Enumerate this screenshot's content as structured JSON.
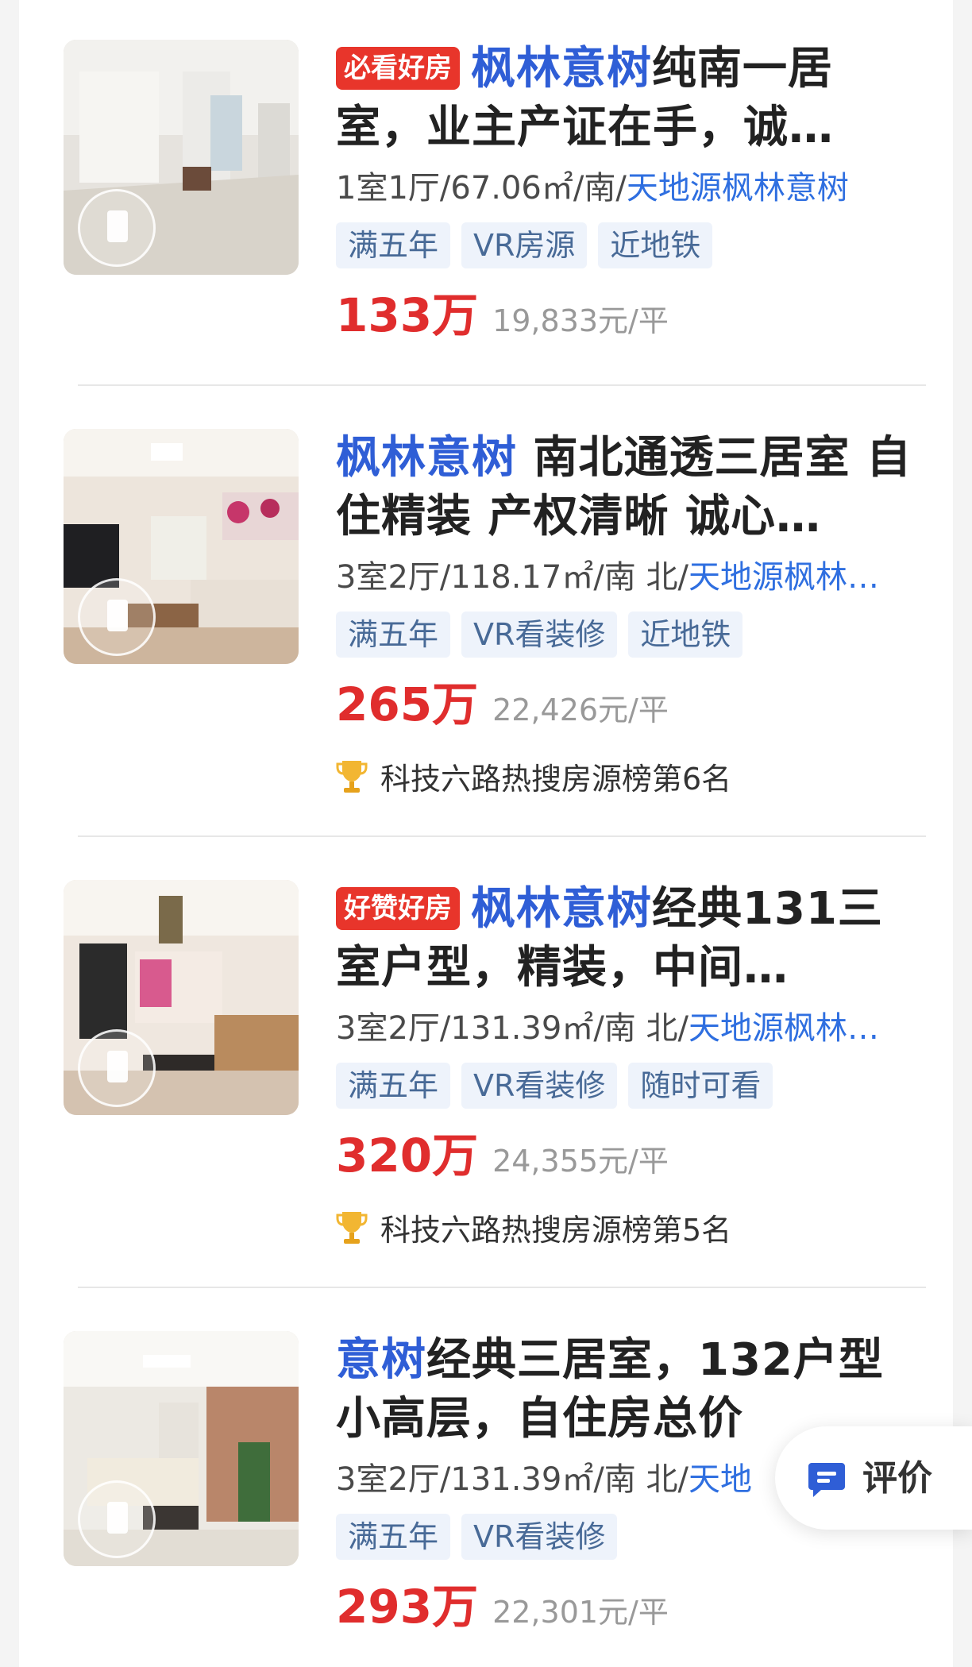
{
  "listings": [
    {
      "badge": "必看好房",
      "community": "枫林意树",
      "title": "纯南一居室，业主产证在手，诚…",
      "layout": "1室1厅/67.06㎡/南/",
      "location": "天地源枫林意树",
      "tags": [
        "满五年",
        "VR房源",
        "近地铁"
      ],
      "price": "133万",
      "unit_price": "19,833元/平",
      "rank": ""
    },
    {
      "badge": "",
      "community": "枫林意树",
      "title": " 南北通透三居室 自住精装 产权清晰 诚心…",
      "layout": "3室2厅/118.17㎡/南 北/",
      "location": "天地源枫林…",
      "tags": [
        "满五年",
        "VR看装修",
        "近地铁"
      ],
      "price": "265万",
      "unit_price": "22,426元/平",
      "rank": "科技六路热搜房源榜第6名"
    },
    {
      "badge": "好赞好房",
      "community": "枫林意树",
      "title": "经典131三室户型，精装，中间…",
      "layout": "3室2厅/131.39㎡/南 北/",
      "location": "天地源枫林…",
      "tags": [
        "满五年",
        "VR看装修",
        "随时可看"
      ],
      "price": "320万",
      "unit_price": "24,355元/平",
      "rank": "科技六路热搜房源榜第5名"
    },
    {
      "badge": "",
      "community": "意树",
      "title": "经典三居室，132户型小高层，自住房总价",
      "layout": "3室2厅/131.39㎡/南 北/",
      "location": "天地",
      "tags": [
        "满五年",
        "VR看装修"
      ],
      "price": "293万",
      "unit_price": "22,301元/平",
      "rank": ""
    }
  ],
  "float_button": {
    "label": "评价",
    "icon": "comment-icon"
  },
  "colors": {
    "community": "#2f5ed6",
    "location": "#2f6fe0",
    "price": "#e02d2d",
    "tag_bg": "#eef3fb",
    "tag_text": "#486a97",
    "badge_bg": "#e8352b"
  }
}
